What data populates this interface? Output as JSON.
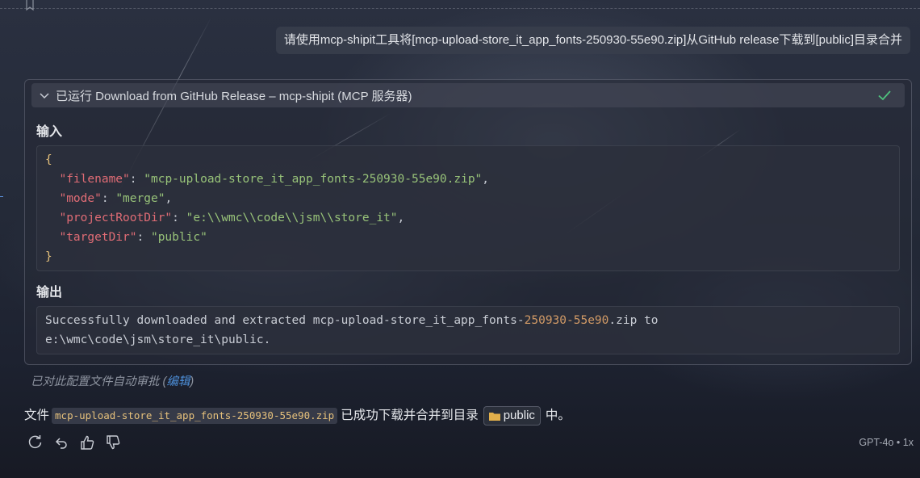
{
  "user_message": {
    "text": "请使用mcp-shipit工具将[mcp-upload-store_it_app_fonts-250930-55e90.zip]从GitHub release下载到[public]目录合并"
  },
  "tool_call": {
    "header": "已运行 Download from GitHub Release – mcp-shipit (MCP 服务器)",
    "status_icon": "check-icon",
    "input_label": "输入",
    "input_json": {
      "open": "{",
      "close": "}",
      "fields": [
        {
          "key": "\"filename\"",
          "sep": ": ",
          "value": "\"mcp-upload-store_it_app_fonts-250930-55e90.zip\"",
          "trail": ","
        },
        {
          "key": "\"mode\"",
          "sep": ": ",
          "value": "\"merge\"",
          "trail": ","
        },
        {
          "key": "\"projectRootDir\"",
          "sep": ": ",
          "value": "\"e:\\\\wmc\\\\code\\\\jsm\\\\store_it\"",
          "trail": ","
        },
        {
          "key": "\"targetDir\"",
          "sep": ": ",
          "value": "\"public\"",
          "trail": ""
        }
      ]
    },
    "output_label": "输出",
    "output": {
      "line1_prefix": "Successfully downloaded and extracted mcp-upload-store_it_app_fonts-",
      "line1_number": "250930-55e90",
      "line1_suffix": ".zip to",
      "line2": "e:\\wmc\\code\\jsm\\store_it\\public."
    }
  },
  "approval": {
    "text": "已对此配置文件自动审批 (",
    "link": "编辑",
    "close": ")"
  },
  "answer": {
    "prefix": "文件",
    "filename_code": "mcp-upload-store_it_app_fonts-250930-55e90.zip",
    "middle": "已成功下载并合并到目录",
    "folder": "public",
    "suffix": "中。"
  },
  "actions": [
    "retry-icon",
    "undo-icon",
    "thumbs-up-icon",
    "thumbs-down-icon"
  ],
  "model_tag": "GPT-4o • 1x",
  "colors": {
    "json_key": "#e06c75",
    "json_string": "#98c379",
    "json_brace": "#e5c07b",
    "link": "#4d8fd9",
    "success": "#4ec27d"
  }
}
